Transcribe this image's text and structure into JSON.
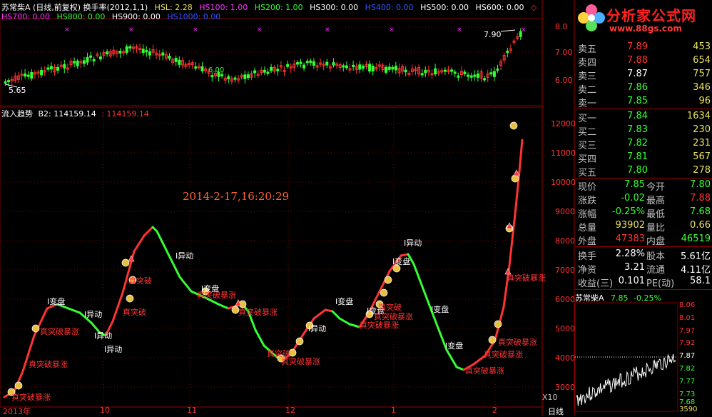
{
  "header": {
    "stock_label": "苏常柴A (日线,前复权) 换手率(2012,1,1)",
    "hsl": "HSL: 2.28",
    "hs100": "HS100: 1.00",
    "hs200": "HS200: 1.00",
    "hs300": "HS300: 0.00",
    "hs400": "HS400: 0.00",
    "hs500": "HS500: 0.00",
    "hs600": "HS600: 0.00",
    "hs700": "HS700: 0.00",
    "hs800": "HS800: 0.00",
    "hs900": "HS900: 0.00",
    "hs1000": "HS1000: 0.00"
  },
  "colors": {
    "red": "#ff3333",
    "green": "#33ff33",
    "white": "#ffffff",
    "yellow": "#e8e060",
    "magenta": "#ff33ff",
    "blue": "#3355ff",
    "grid": "#7a0000"
  },
  "price_pane": {
    "high_label": "7.90",
    "low_label": "5.65",
    "mark_label": "6.00",
    "y_ticks": [
      "8.0",
      "7.00",
      "6.00"
    ]
  },
  "indicator_pane": {
    "title": "流入趋势",
    "b2": "B2: 114159.14",
    "b2_value": ": 114159.14",
    "y_ticks": [
      "12000",
      "11000",
      "10000",
      "9000",
      "8000",
      "7000",
      "6000",
      "5000",
      "4000",
      "3000"
    ],
    "x10": "X10",
    "datetime": "2014-2-17,16:20:29"
  },
  "x_axis": {
    "labels": [
      "2013年",
      "10",
      "11",
      "12",
      "1",
      "2"
    ],
    "period": "日线"
  },
  "annotations": {
    "white": [
      "I变盘",
      "I异动",
      "I异动",
      "I异动",
      "I异动",
      "I变盘",
      "I异动",
      "I变盘",
      "I变盘",
      "I异动",
      "I变盘",
      "I变盘",
      "I变盘"
    ],
    "red": [
      "真突破暴涨",
      "真突破暴涨",
      "真突破暴涨",
      "真突破",
      "真突破",
      "真突破暴涨",
      "真突破暴涨",
      "真突破",
      "真突破暴涨",
      "真突破暴涨",
      "真突破",
      "真突破暴涨",
      "真突破暴涨",
      "真突破暴涨",
      "真突破暴涨",
      "真突破暴涨"
    ]
  },
  "logo": {
    "title": "分析家公式网",
    "url": "www.88gs.com"
  },
  "quotes": {
    "sell": [
      {
        "label": "卖五",
        "price": "7.89",
        "vol": "453"
      },
      {
        "label": "卖四",
        "price": "7.88",
        "vol": "654"
      },
      {
        "label": "卖三",
        "price": "7.87",
        "vol": "757"
      },
      {
        "label": "卖二",
        "price": "7.86",
        "vol": "346"
      },
      {
        "label": "卖一",
        "price": "7.85",
        "vol": "96"
      }
    ],
    "buy": [
      {
        "label": "买一",
        "price": "7.84",
        "vol": "1634"
      },
      {
        "label": "买二",
        "price": "7.83",
        "vol": "230"
      },
      {
        "label": "买三",
        "price": "7.82",
        "vol": "231"
      },
      {
        "label": "买四",
        "price": "7.81",
        "vol": "567"
      },
      {
        "label": "买五",
        "price": "7.80",
        "vol": "278"
      }
    ]
  },
  "stats": [
    {
      "l1": "现价",
      "v1": "7.85",
      "l2": "今开",
      "v2": "7.80"
    },
    {
      "l1": "涨跌",
      "v1": "-0.02",
      "l2": "最高",
      "v2": "7.88"
    },
    {
      "l1": "涨幅",
      "v1": "-0.25%",
      "l2": "最低",
      "v2": "7.68"
    },
    {
      "l1": "总量",
      "v1": "93902",
      "l2": "量比",
      "v2": "0.66"
    },
    {
      "l1": "外盘",
      "v1": "47383",
      "l2": "内盘",
      "v2": "46519"
    }
  ],
  "stats2": [
    {
      "l1": "换手",
      "v1": "2.28%",
      "l2": "股本",
      "v2": "5.61亿"
    },
    {
      "l1": "净资",
      "v1": "3.21",
      "l2": "流通",
      "v2": "4.11亿"
    },
    {
      "l1": "收益(三)",
      "v1": "0.101",
      "l2": "PE(动)",
      "v2": "58.1"
    }
  ],
  "mini_chart": {
    "name": "苏常柴A",
    "price": "7.85",
    "change": "-0.25%",
    "y_ticks": [
      "8.06",
      "8.01",
      "7.97",
      "7.92",
      "7.87",
      "7.82",
      "7.77",
      "7.73",
      "7.68"
    ],
    "volume": "3590"
  }
}
